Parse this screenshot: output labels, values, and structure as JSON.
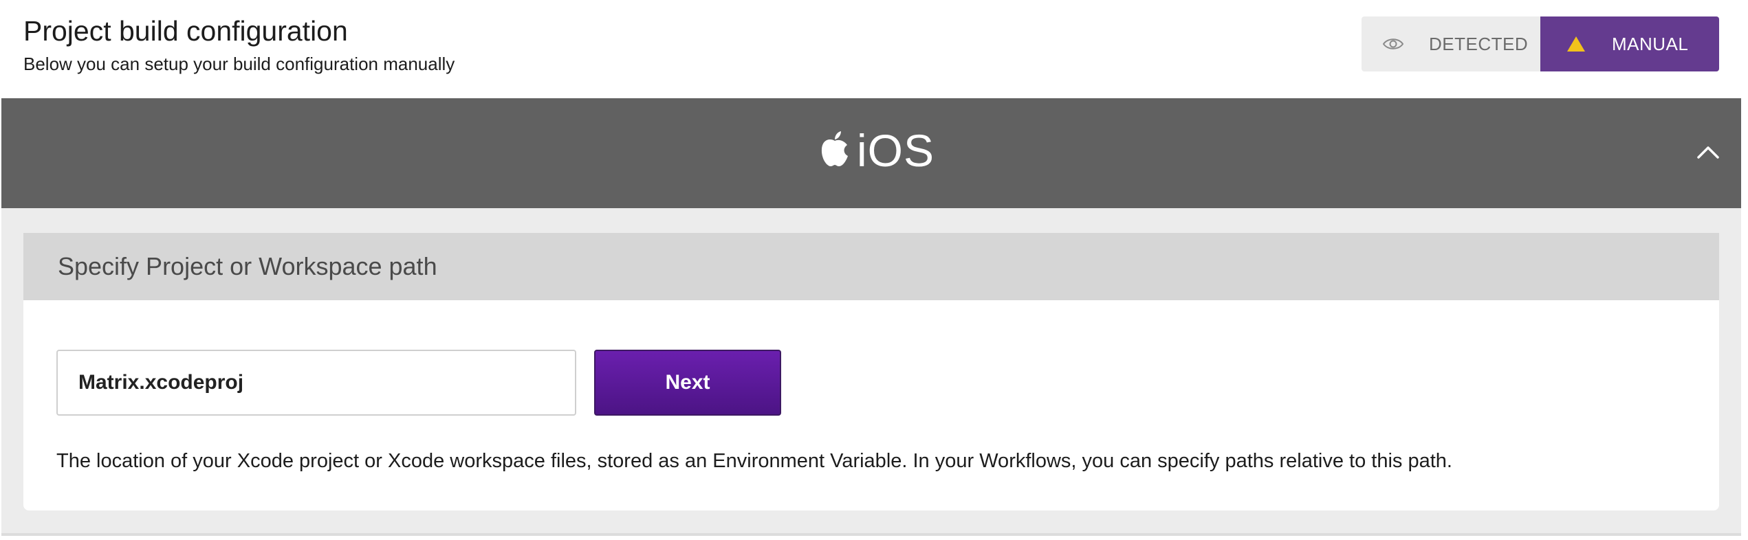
{
  "header": {
    "title": "Project build configuration",
    "subtitle": "Below you can setup your build configuration manually"
  },
  "mode_toggle": {
    "detected": {
      "label": "DETECTED",
      "icon": "eye-icon",
      "selected": false
    },
    "manual": {
      "label": "MANUAL",
      "icon": "warning-triangle-icon",
      "selected": true
    }
  },
  "platform": {
    "label": "iOS",
    "icon": "apple-icon",
    "collapse_icon": "chevron-up-icon",
    "expanded": true
  },
  "section": {
    "title": "Specify Project or Workspace path",
    "path_value": "Matrix.xcodeproj",
    "next_label": "Next",
    "help_text": "The location of your Xcode project or Xcode workspace files, stored as an Environment Variable. In your Workflows, you can specify paths relative to this path."
  },
  "colors": {
    "accent_purple": "#643b8f",
    "next_button": "#5a1a9a",
    "platform_bar": "#616161",
    "warning_yellow": "#f2c21b"
  }
}
